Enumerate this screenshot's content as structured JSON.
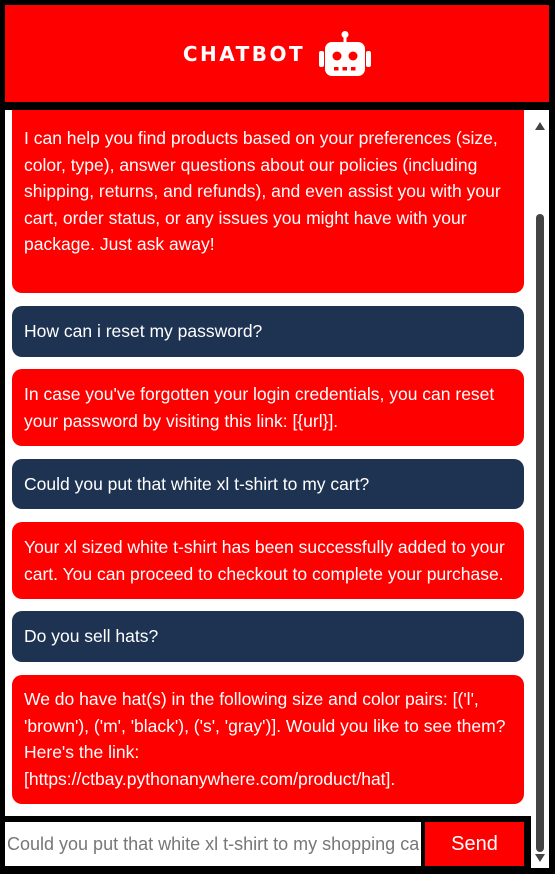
{
  "header": {
    "title": "CHATBOT",
    "icon": "robot-icon"
  },
  "colors": {
    "accent": "#ff0000",
    "user_bubble": "#1e3252",
    "background": "#000000"
  },
  "messages": [
    {
      "sender": "bot",
      "text": "I can help you find products based on your preferences (size, color, type), answer questions about our policies (including shipping, returns, and refunds), and even assist you with your cart, order status, or any issues you might have with your package. Just ask away!"
    },
    {
      "sender": "user",
      "text": "How can i reset my password?"
    },
    {
      "sender": "bot",
      "text": "In case you've forgotten your login credentials, you can reset your password by visiting this link: [{url}]."
    },
    {
      "sender": "user",
      "text": "Could you put that white xl t-shirt to my cart?"
    },
    {
      "sender": "bot",
      "text": "Your xl sized white t-shirt has been successfully added to your cart. You can proceed to checkout to complete your purchase."
    },
    {
      "sender": "user",
      "text": "Do you sell hats?"
    },
    {
      "sender": "bot",
      "text": "We do have hat(s) in the following size and color pairs: [('l', 'brown'), ('m', 'black'), ('s', 'gray')]. Would you like to see them? Here's the link: [https://ctbay.pythonanywhere.com/product/hat]."
    }
  ],
  "input": {
    "placeholder": "Could you put that white xl t-shirt to my shopping cart",
    "value": ""
  },
  "send_label": "Send"
}
